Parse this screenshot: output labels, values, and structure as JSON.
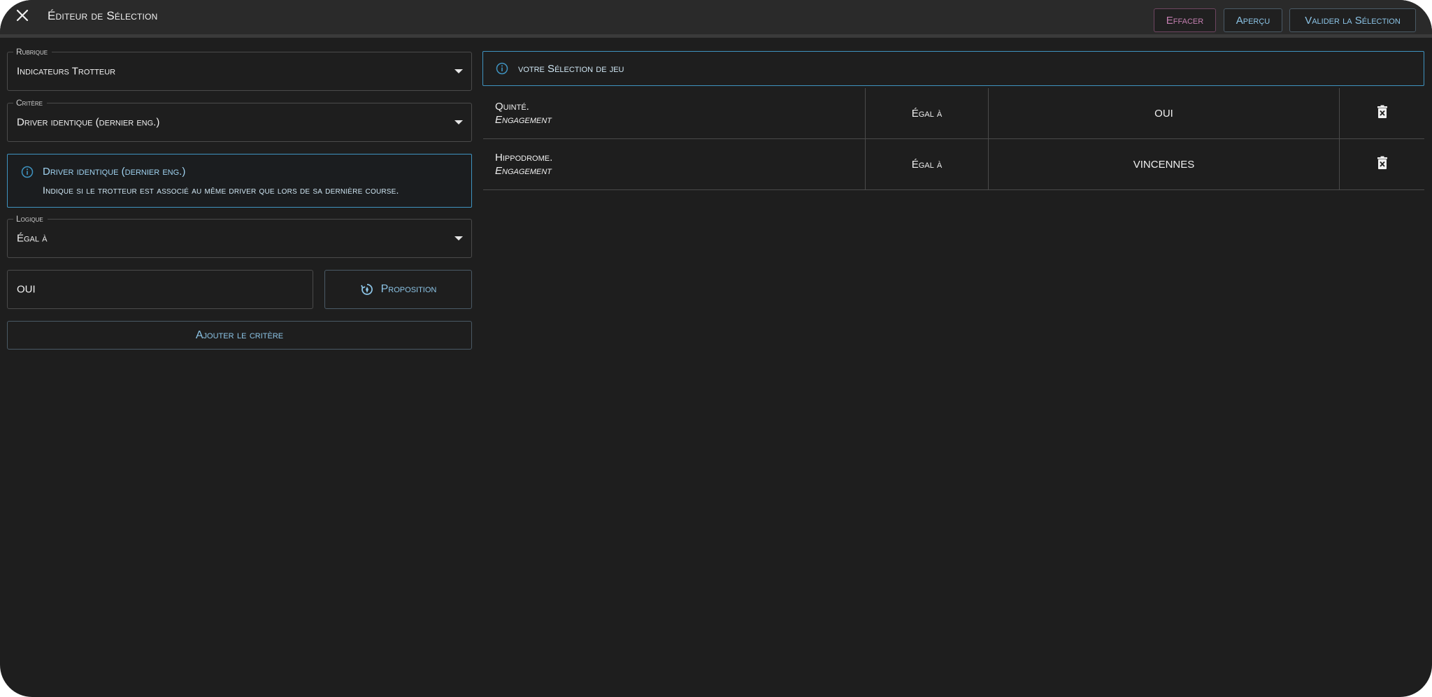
{
  "header": {
    "title": "Éditeur de Sélection",
    "buttons": {
      "clear": "Effacer",
      "preview": "Aperçu",
      "validate": "Valider la Sélection"
    }
  },
  "form": {
    "rubrique": {
      "label": "Rubrique",
      "value": "Indicateurs Trotteur"
    },
    "critere": {
      "label": "Critère",
      "value": "Driver identique (dernier eng.)"
    },
    "info": {
      "title": "Driver identique (dernier eng.)",
      "description": "Indique si le trotteur est associé au même driver que lors de sa dernière course."
    },
    "logique": {
      "label": "Logique",
      "value": "Égal à"
    },
    "value_input": "OUI",
    "proposition_label": "Proposition",
    "add_label": "Ajouter le critère"
  },
  "selection": {
    "title": "votre Sélection de jeu",
    "rows": [
      {
        "name": "Quinté.",
        "category": "Engagement",
        "operator": "Égal à",
        "value": "OUI"
      },
      {
        "name": "Hippodrome.",
        "category": "Engagement",
        "operator": "Égal à",
        "value": "VINCENNES"
      }
    ]
  },
  "colors": {
    "background": "#1e1e1e",
    "accent": "#3f93c0",
    "button_text": "#8cc4e6",
    "clear_button": "#c47fb0"
  },
  "icons": [
    "close-icon",
    "caret-down-icon",
    "info-icon",
    "proposition-icon",
    "trash-icon"
  ]
}
